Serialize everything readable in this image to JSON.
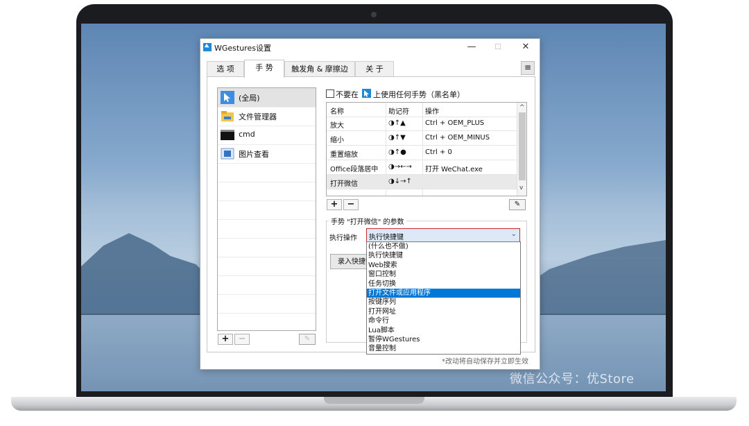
{
  "window": {
    "title": "WGestures设置",
    "controls": {
      "minimize": "—",
      "maximize": "☐",
      "close": "✕"
    }
  },
  "tabs": [
    {
      "label": "选 项",
      "active": false
    },
    {
      "label": "手 势",
      "active": true
    },
    {
      "label": "触发角 & 摩擦边",
      "active": false
    },
    {
      "label": "关 于",
      "active": false
    }
  ],
  "menu_button": "≡",
  "apps": [
    {
      "label": "(全局)",
      "icon": "cursor-icon",
      "selected": true
    },
    {
      "label": "文件管理器",
      "icon": "folder-icon",
      "selected": false
    },
    {
      "label": "cmd",
      "icon": "terminal-icon",
      "selected": false
    },
    {
      "label": "图片查看",
      "icon": "image-viewer-icon",
      "selected": false
    }
  ],
  "apps_add": "+",
  "apps_remove": "−",
  "blacklist": {
    "text_before": "不要在",
    "text_after": "上使用任何手势（黑名单）"
  },
  "gesture_table": {
    "headers": [
      "名称",
      "助记符",
      "操作"
    ],
    "rows": [
      {
        "name": "放大",
        "mnemonic": "◑↑▲",
        "action": "Ctrl + OEM_PLUS",
        "highlight": false
      },
      {
        "name": "缩小",
        "mnemonic": "◑↑▼",
        "action": "Ctrl + OEM_MINUS",
        "highlight": false
      },
      {
        "name": "重置缩放",
        "mnemonic": "◑↑●",
        "action": "Ctrl + 0",
        "highlight": false
      },
      {
        "name": "Office段落居中",
        "mnemonic": "◑→←→",
        "action": "打开 WeChat.exe",
        "highlight": false
      },
      {
        "name": "打开微信",
        "mnemonic": "◑↓→↑",
        "action": "",
        "highlight": true
      }
    ]
  },
  "gesture_add": "+",
  "gesture_remove": "−",
  "params": {
    "title": "手势 \"打开微信\" 的参数",
    "exec_label": "执行操作",
    "selected_value": "执行快捷键",
    "record_button": "录入快捷键",
    "dropdown_options": [
      "(什么也不做)",
      "执行快捷键",
      "Web搜索",
      "窗口控制",
      "任务切换",
      "打开文件或应用程序",
      "按键序列",
      "打开网址",
      "命令行",
      "Lua脚本",
      "暂停WGestures",
      "音量控制"
    ],
    "highlighted_option_index": 5
  },
  "footer_note": "*改动将自动保存并立即生效",
  "watermark": "微信公众号：优Store",
  "colors": {
    "accent": "#0078d7",
    "select_border": "#c62b2b",
    "select_bg": "#dde9f6",
    "app_icon": "#1e88d9"
  }
}
